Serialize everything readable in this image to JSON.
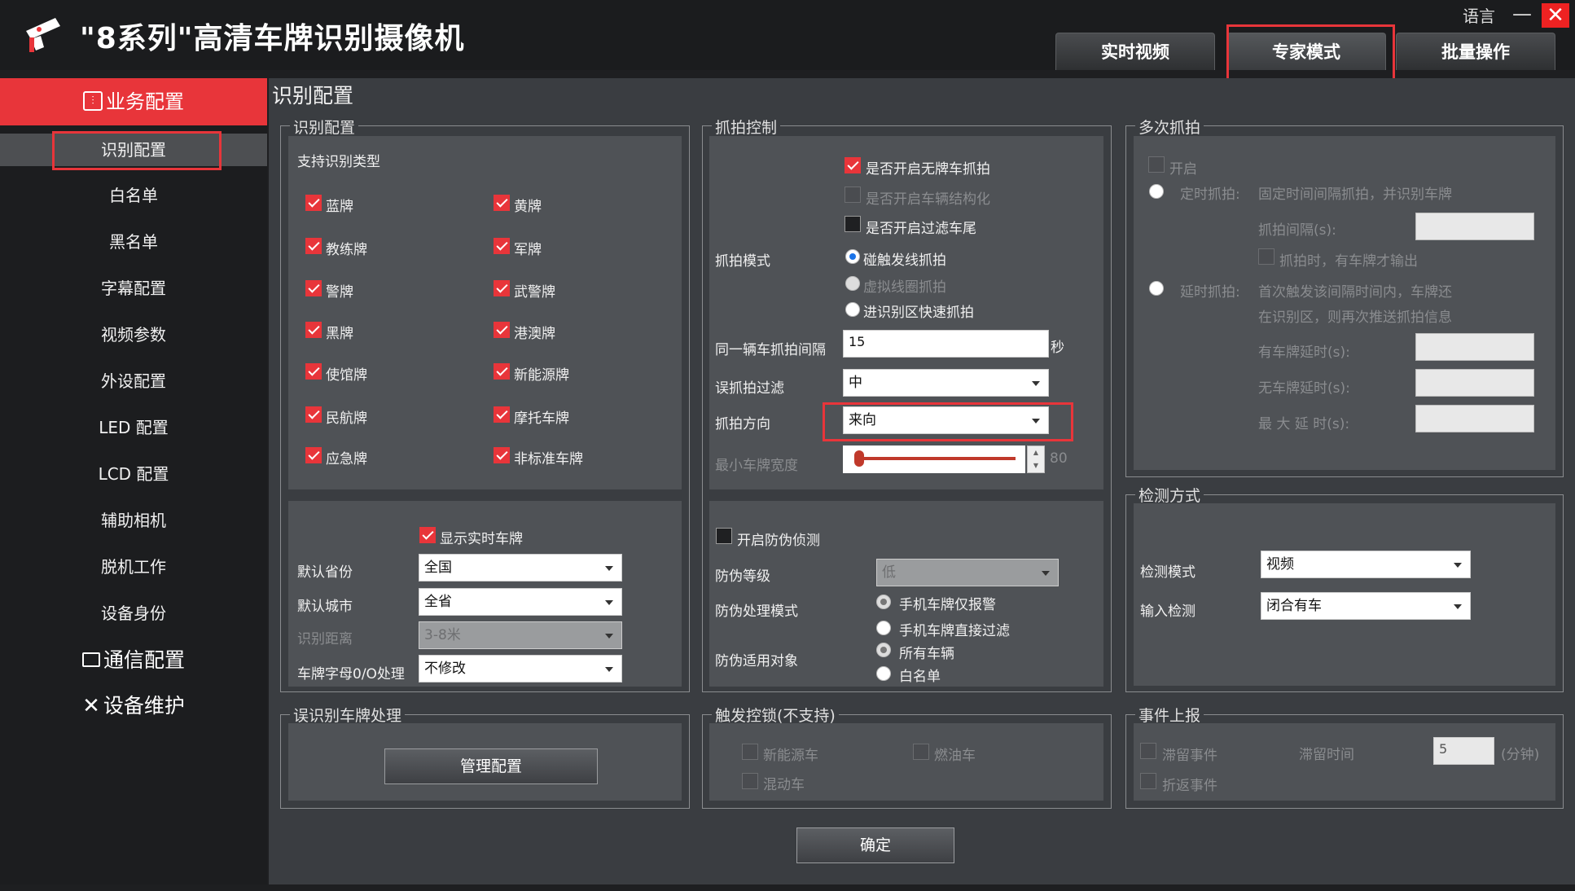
{
  "app": {
    "title": "\"8系列\"高清车牌识别摄像机",
    "language": "语言",
    "minimize": "—",
    "close": "✕"
  },
  "tabs": [
    {
      "label": "实时视频"
    },
    {
      "label": "专家模式"
    },
    {
      "label": "批量操作"
    }
  ],
  "sidebar": {
    "business": "业务配置",
    "items": [
      "识别配置",
      "白名单",
      "黑名单",
      "字幕配置",
      "视频参数",
      "外设配置",
      "LED 配置",
      "LCD 配置",
      "辅助相机",
      "脱机工作",
      "设备身份"
    ],
    "comm": "通信配置",
    "maint": "设备维护"
  },
  "page": {
    "title": "识别配置"
  },
  "recog": {
    "group_label": "识别配置",
    "types_label": "支持识别类型",
    "types": [
      "蓝牌",
      "黄牌",
      "教练牌",
      "军牌",
      "警牌",
      "武警牌",
      "黑牌",
      "港澳牌",
      "使馆牌",
      "新能源牌",
      "民航牌",
      "摩托车牌",
      "应急牌",
      "非标准车牌"
    ],
    "show_realtime": "显示实时车牌",
    "province_label": "默认省份",
    "province_value": "全国",
    "city_label": "默认城市",
    "city_value": "全省",
    "distance_label": "识别距离",
    "distance_value": "3-8米",
    "letter_label": "车牌字母0/O处理",
    "letter_value": "不修改"
  },
  "misrecog": {
    "group_label": "误识别车牌处理",
    "manage_button": "管理配置"
  },
  "capture": {
    "group_label": "抓拍控制",
    "no_plate": "是否开启无牌车抓拍",
    "structured": "是否开启车辆结构化",
    "filter_tail": "是否开启过滤车尾",
    "mode_label": "抓拍模式",
    "mode_opts": [
      "碰触发线抓拍",
      "虚拟线圈抓拍",
      "进识别区快速抓拍"
    ],
    "interval_label": "同一辆车抓拍间隔",
    "interval_value": "15",
    "interval_unit": "秒",
    "filter_label": "误抓拍过滤",
    "filter_value": "中",
    "dir_label": "抓拍方向",
    "dir_value": "来向",
    "minwidth_label": "最小车牌宽度",
    "minwidth_value": "80"
  },
  "anti": {
    "enable": "开启防伪侦测",
    "level_label": "防伪等级",
    "level_value": "低",
    "mode_label": "防伪处理模式",
    "mode_opts": [
      "手机车牌仅报警",
      "手机车牌直接过滤"
    ],
    "target_label": "防伪适用对象",
    "target_opts": [
      "所有车辆",
      "白名单"
    ]
  },
  "trigger": {
    "group_label": "触发控锁(不支持)",
    "opts": [
      "新能源车",
      "燃油车",
      "混动车"
    ]
  },
  "multi": {
    "group_label": "多次抓拍",
    "enable": "开启",
    "timed_label": "定时抓拍:",
    "timed_desc": "固定时间间隔抓拍，并识别车牌",
    "interval_label": "抓拍间隔(s):",
    "output_only": "抓拍时，有车牌才输出",
    "delay_label": "延时抓拍:",
    "delay_desc1": "首次触发该间隔时间内，车牌还",
    "delay_desc2": "在识别区，则再次推送抓拍信息",
    "plate_delay": "有车牌延时(s):",
    "noplate_delay": "无车牌延时(s):",
    "max_delay": "最 大 延 时(s):"
  },
  "detect": {
    "group_label": "检测方式",
    "mode_label": "检测模式",
    "mode_value": "视频",
    "input_label": "输入检测",
    "input_value": "闭合有车"
  },
  "events": {
    "group_label": "事件上报",
    "stay": "滞留事件",
    "stay_time": "滞留时间",
    "stay_value": "5",
    "stay_unit": "(分钟)",
    "return": "折返事件"
  },
  "confirm": "确定",
  "colors": {
    "accent": "#e8353a",
    "panel": "#4f5256",
    "bg": "#3a3d41"
  }
}
